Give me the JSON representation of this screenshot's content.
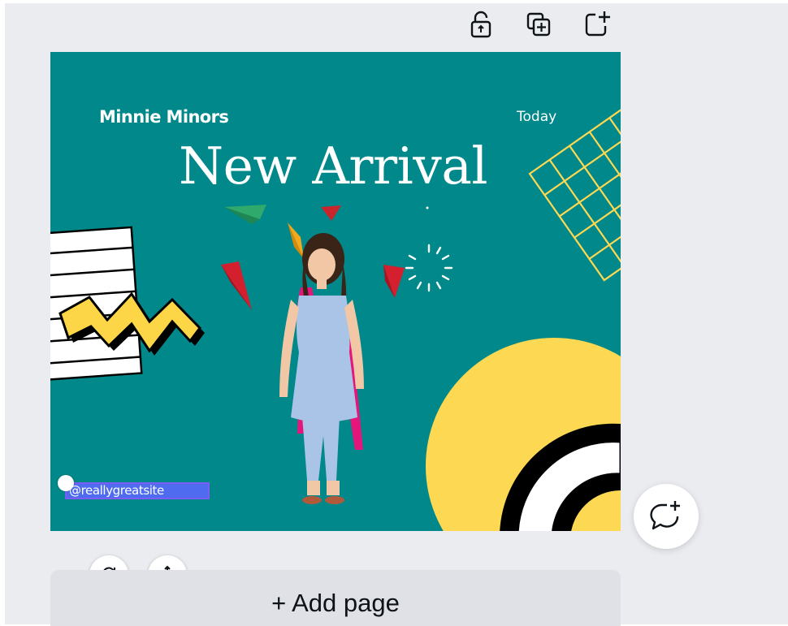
{
  "toolbar": {
    "lock_icon": "unlock-icon",
    "duplicate_icon": "duplicate-page-icon",
    "add_icon": "add-page-icon"
  },
  "design": {
    "brand": "Minnie Minors",
    "date_label": "Today",
    "headline": "New Arrival",
    "website": "@reallygreatsite",
    "colors": {
      "background": "#00888a",
      "yellow": "#fdd852",
      "accent": "#e5167b"
    }
  },
  "controls": {
    "rotate_icon": "rotate-icon",
    "move_icon": "move-icon",
    "comment_icon": "add-comment-icon"
  },
  "add_page": {
    "label": "+ Add page"
  }
}
